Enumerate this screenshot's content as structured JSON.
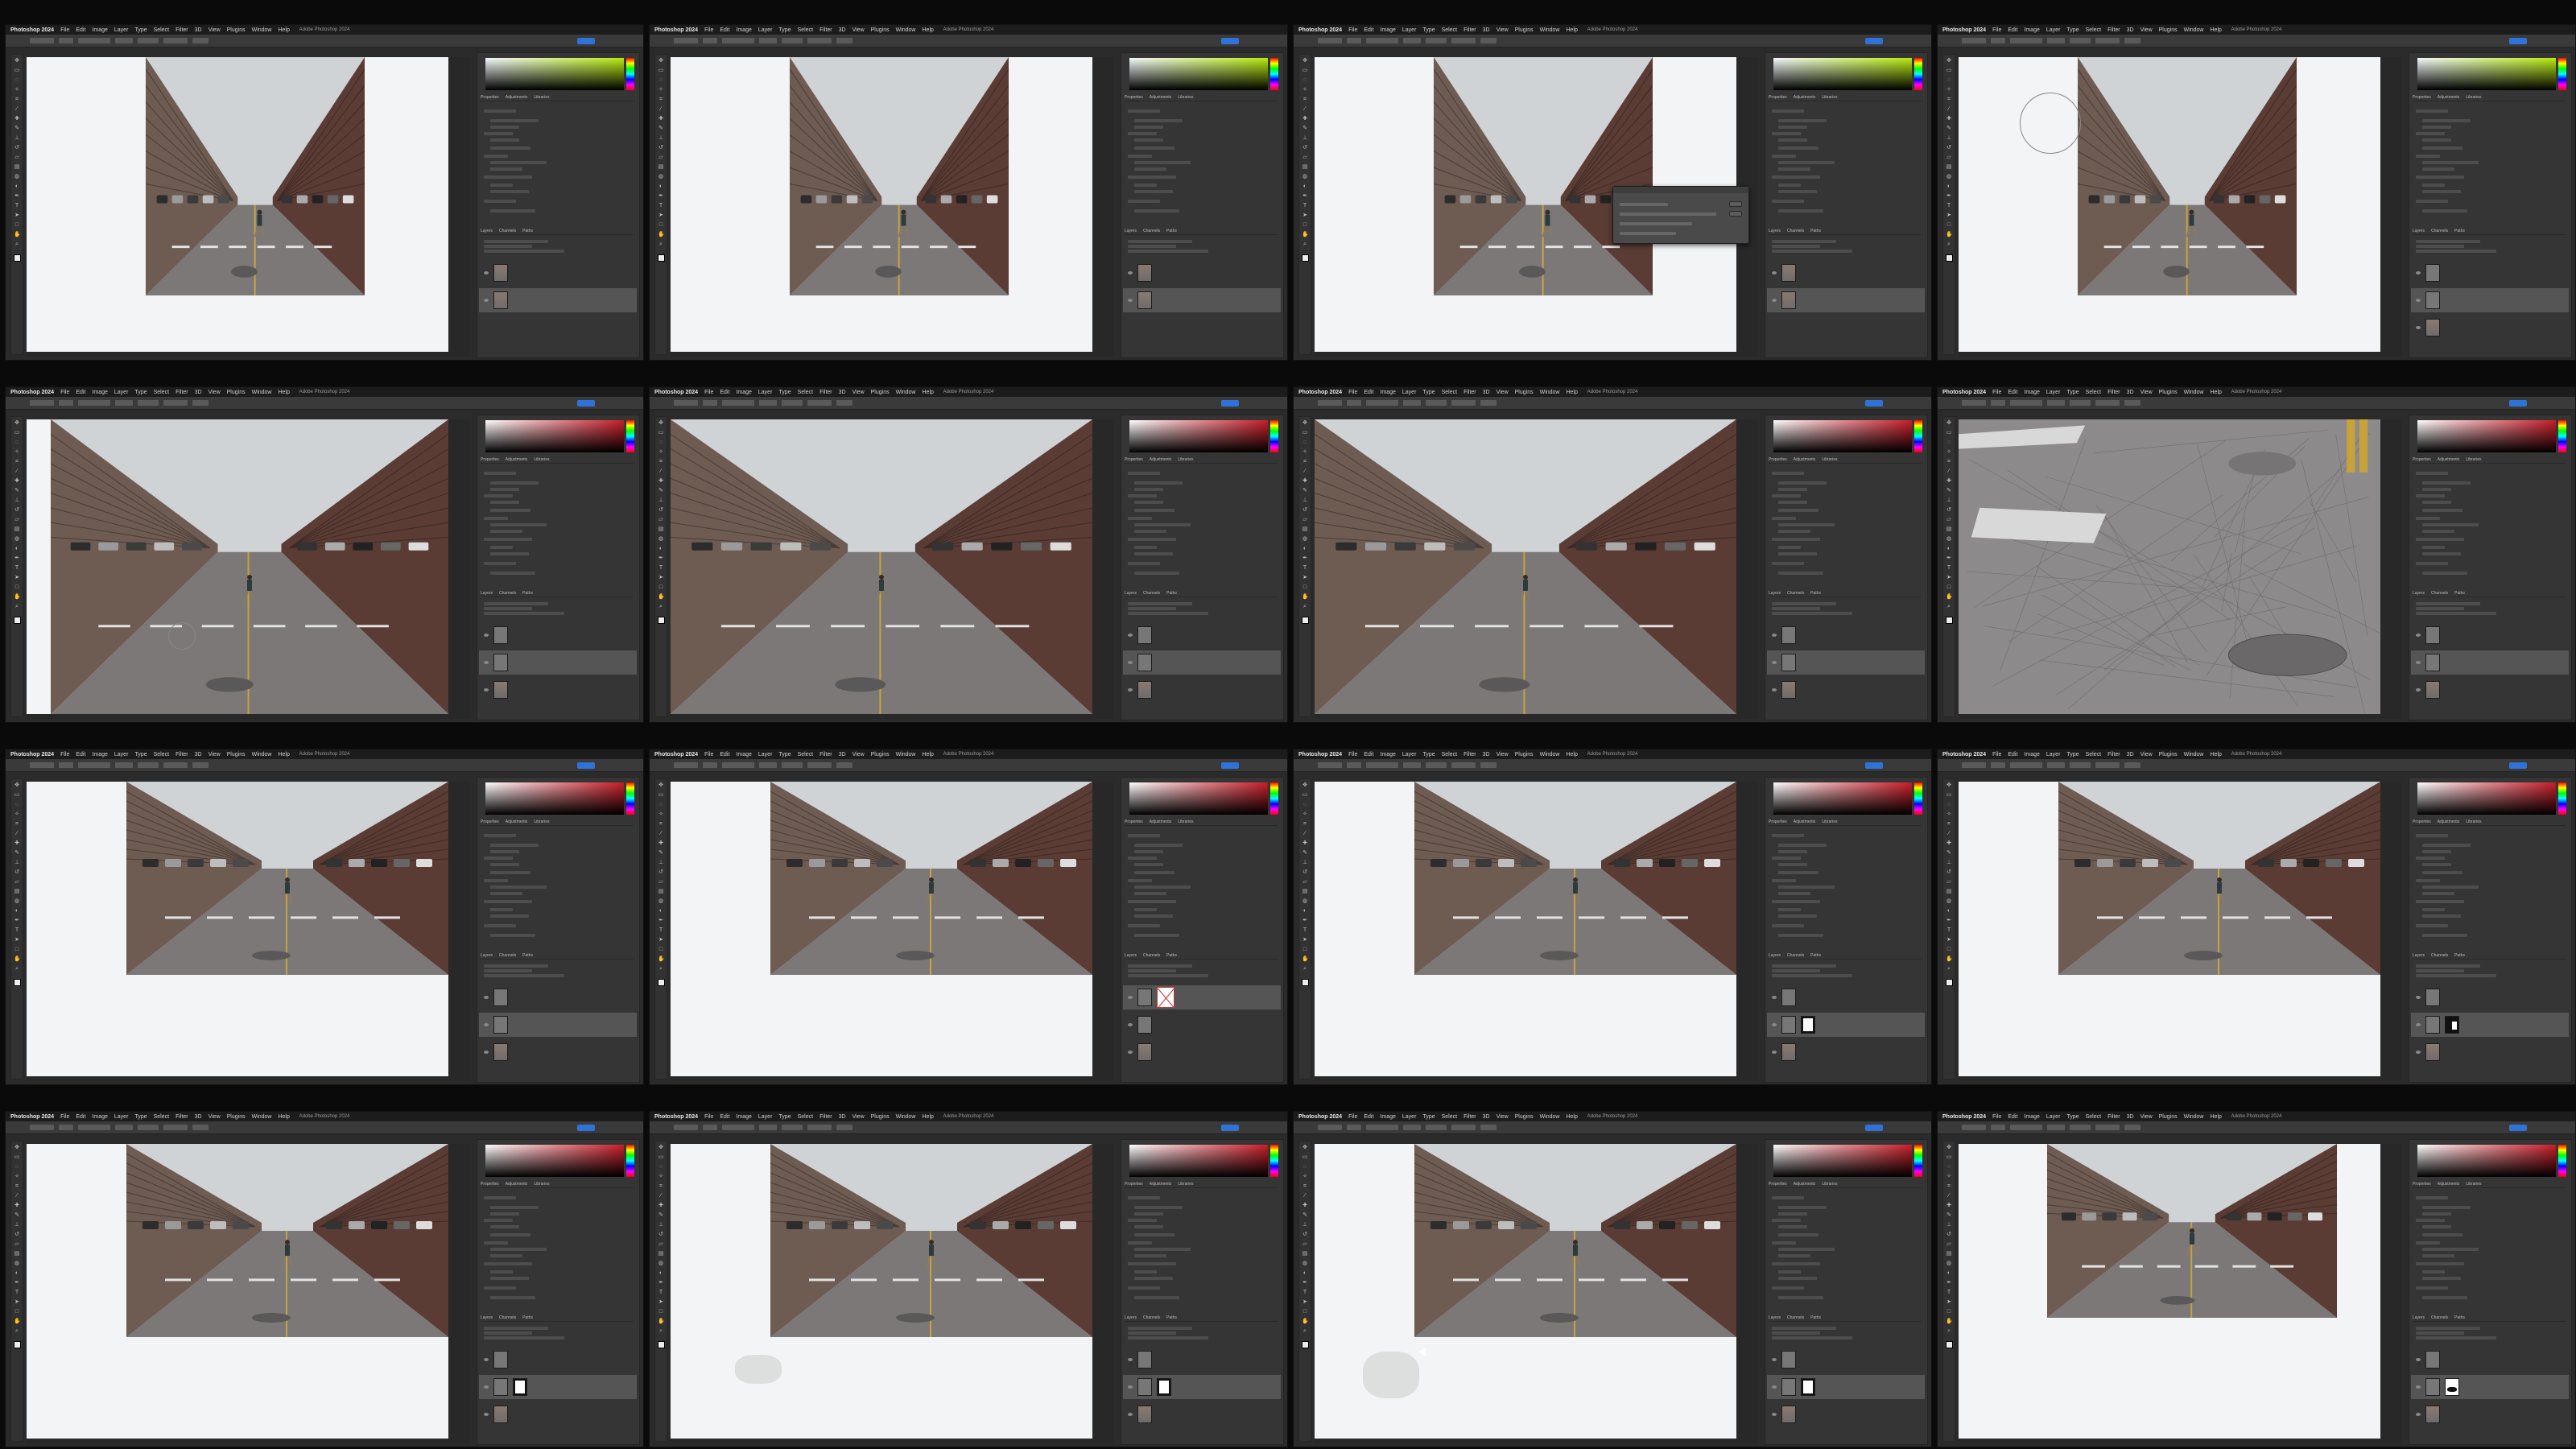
{
  "app": {
    "name": "Photoshop 2024",
    "menus": [
      "File",
      "Edit",
      "Image",
      "Layer",
      "Type",
      "Select",
      "Filter",
      "3D",
      "View",
      "Plugins",
      "Window",
      "Help"
    ],
    "window_title": "Adobe Photoshop 2024"
  },
  "colors": {
    "yellow_green_gradient": [
      "#f4f9ff",
      "#b8ea10",
      "#000000"
    ],
    "red_gradient": [
      "#ffffff",
      "#c81e2a",
      "#000000"
    ],
    "canvas_white": "#f2f4f5",
    "panel_bg": "#353535",
    "share_blue": "#2f73d8"
  },
  "tools": [
    "move-icon",
    "marquee-icon",
    "lasso-icon",
    "magic-wand-icon",
    "crop-icon",
    "eyedropper-icon",
    "healing-icon",
    "brush-icon",
    "stamp-icon",
    "history-brush-icon",
    "eraser-icon",
    "gradient-icon",
    "blur-icon",
    "dodge-icon",
    "pen-icon",
    "type-icon",
    "path-select-icon",
    "shape-icon",
    "hand-icon",
    "zoom-icon"
  ],
  "panel_labels": {
    "properties": [
      "Properties",
      "Adjustments",
      "Libraries"
    ],
    "layers": [
      "Layers",
      "Channels",
      "Paths"
    ]
  },
  "frames": [
    {
      "id": 1,
      "gradient": "yellow",
      "view": "portrait",
      "dialog": false,
      "cursor": "none",
      "layers": [
        "photo",
        "photo-active"
      ]
    },
    {
      "id": 2,
      "gradient": "yellow",
      "view": "portrait",
      "dialog": false,
      "cursor": "none",
      "layers": [
        "photo",
        "photo-active"
      ]
    },
    {
      "id": 3,
      "gradient": "yellow",
      "view": "portrait",
      "dialog": true,
      "cursor": "none",
      "layers": [
        "photo",
        "photo-active"
      ]
    },
    {
      "id": 4,
      "gradient": "yellow",
      "view": "portrait-brush",
      "dialog": false,
      "cursor": "brush",
      "layers": [
        "gray",
        "gray-active",
        "photo"
      ]
    },
    {
      "id": 5,
      "gradient": "red",
      "view": "street-wide",
      "dialog": false,
      "cursor": "brush-small",
      "layers": [
        "gray",
        "gray-active",
        "photo"
      ]
    },
    {
      "id": 6,
      "gradient": "red",
      "view": "street-zoom",
      "dialog": false,
      "cursor": "none",
      "layers": [
        "gray",
        "gray-active",
        "photo"
      ]
    },
    {
      "id": 7,
      "gradient": "red",
      "view": "street-zoom2",
      "dialog": false,
      "cursor": "none",
      "layers": [
        "gray",
        "gray-active",
        "photo"
      ]
    },
    {
      "id": 8,
      "gradient": "red",
      "view": "asphalt",
      "dialog": false,
      "cursor": "none",
      "layers": [
        "gray",
        "gray-active",
        "photo"
      ]
    },
    {
      "id": 9,
      "gradient": "red",
      "view": "crosswalk",
      "dialog": false,
      "cursor": "none",
      "layers": [
        "gray",
        "gray-active",
        "photo"
      ]
    },
    {
      "id": 10,
      "gradient": "red",
      "view": "crosswalk",
      "dialog": false,
      "cursor": "none",
      "layers": [
        "mask-x",
        "gray",
        "photo"
      ]
    },
    {
      "id": 11,
      "gradient": "red",
      "view": "crosswalk",
      "dialog": false,
      "cursor": "none",
      "layers": [
        "gray",
        "mask-white",
        "photo"
      ]
    },
    {
      "id": 12,
      "gradient": "red",
      "view": "crosswalk",
      "dialog": false,
      "cursor": "none",
      "layers": [
        "gray",
        "mask-white-small",
        "photo"
      ]
    },
    {
      "id": 13,
      "gradient": "red",
      "view": "crosswalk",
      "dialog": false,
      "cursor": "none",
      "layers": [
        "gray",
        "mask-white",
        "photo"
      ]
    },
    {
      "id": 14,
      "gradient": "red",
      "view": "crosswalk-paint",
      "dialog": false,
      "cursor": "none",
      "layers": [
        "gray",
        "mask-white",
        "photo"
      ]
    },
    {
      "id": 15,
      "gradient": "red",
      "view": "crosswalk-paint2",
      "dialog": false,
      "cursor": "arrow",
      "layers": [
        "gray",
        "mask-white",
        "photo"
      ]
    },
    {
      "id": 16,
      "gradient": "red",
      "view": "street-framed",
      "dialog": false,
      "cursor": "none",
      "layers": [
        "gray",
        "mask-black-blob",
        "photo"
      ]
    }
  ]
}
